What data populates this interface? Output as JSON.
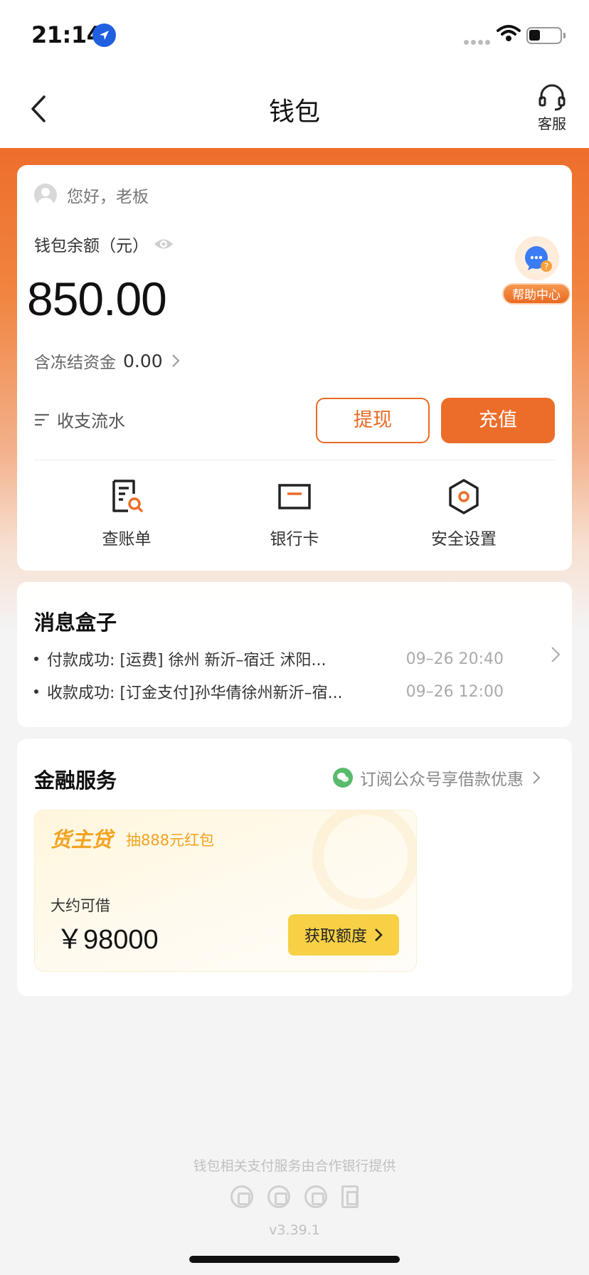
{
  "status_bar": {
    "time": "21:14"
  },
  "header": {
    "title": "钱包",
    "support_label": "客服"
  },
  "wallet": {
    "greeting": "您好，老板",
    "balance_label": "钱包余额（元）",
    "balance": "850.00",
    "frozen_label": "含冻结资金",
    "frozen_value": "0.00",
    "help_center_label": "帮助中心",
    "ledger_label": "收支流水",
    "withdraw_label": "提现",
    "recharge_label": "充值",
    "quick_actions": [
      {
        "label": "查账单",
        "icon": "bill-search-icon"
      },
      {
        "label": "银行卡",
        "icon": "bank-card-icon"
      },
      {
        "label": "安全设置",
        "icon": "security-hexagon-icon"
      }
    ]
  },
  "messages": {
    "title": "消息盒子",
    "items": [
      {
        "text": "付款成功: [运费] 徐州 新沂–宿迁 沭阳...",
        "time": "09–26 20:40"
      },
      {
        "text": "收款成功: [订金支付]孙华倩徐州新沂–宿...",
        "time": "09–26 12:00"
      }
    ]
  },
  "finance": {
    "title": "金融服务",
    "subscribe_link": "订阅公众号享借款优惠",
    "loan": {
      "name": "货主贷",
      "promo": "抽888元红包",
      "estimate_label": "大约可借",
      "amount": "￥98000",
      "cta": "获取额度"
    }
  },
  "footer": {
    "note": "钱包相关支付服务由合作银行提供",
    "version": "v3.39.1"
  },
  "colors": {
    "accent": "#ec6d29",
    "loan_gold": "#f2a322",
    "loan_button": "#f7d046",
    "location_blue": "#1f5fe0"
  }
}
